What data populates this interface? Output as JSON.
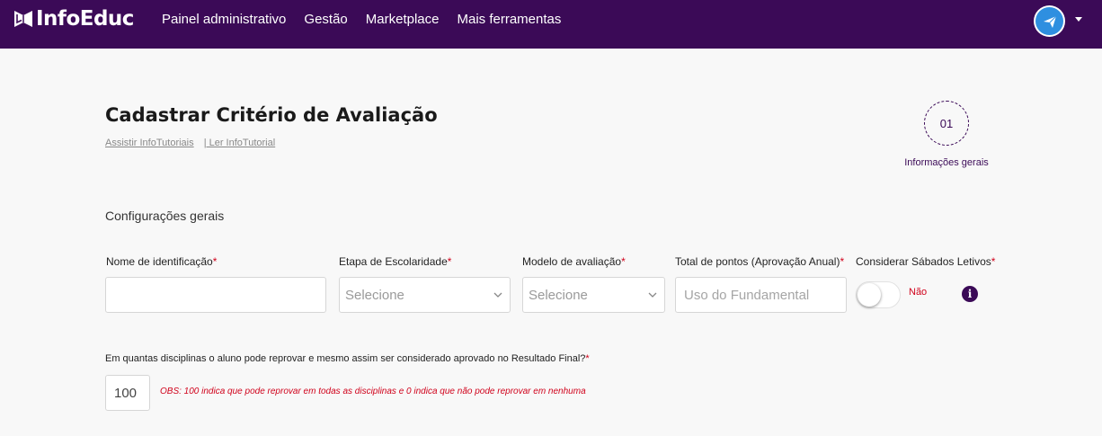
{
  "app": {
    "logo_text": "InfoEduc",
    "brand_color": "#3b0a57",
    "accent_color": "#2e8fe0",
    "required_color": "#d0021b"
  },
  "nav": {
    "items": [
      {
        "label": "Painel administrativo"
      },
      {
        "label": "Gestão"
      },
      {
        "label": "Marketplace"
      },
      {
        "label": "Mais ferramentas"
      }
    ],
    "avatar_icon": "paper-plane-icon",
    "menu_icon": "caret-down-icon"
  },
  "header": {
    "title": "Cadastrar Critério de Avaliação",
    "link_watch": "Assistir InfoTutoriais",
    "link_read": "| Ler InfoTutorial"
  },
  "stepper": {
    "step_number": "01",
    "step_label": "Informações gerais"
  },
  "section": {
    "title": "Configurações gerais"
  },
  "form": {
    "required_mark": "*",
    "name_field": {
      "label": "Nome de identificação",
      "value": "",
      "placeholder": ""
    },
    "stage_field": {
      "label": "Etapa de Escolaridade",
      "selected": "Selecione"
    },
    "model_field": {
      "label": "Modelo de avaliação",
      "selected": "Selecione"
    },
    "points_field": {
      "label": "Total de pontos (Aprovação Anual)",
      "value": "",
      "placeholder": "Uso do Fundamental"
    },
    "saturdays_field": {
      "label": "Considerar Sábados Letivos",
      "state_label": "Não",
      "checked": false
    },
    "info_icon": "info-icon",
    "failures_question": "Em quantas disciplinas o aluno pode reprovar e mesmo assim ser considerado aprovado no Resultado Final?",
    "failures_value": "100",
    "failures_obs": "OBS: 100 indica que pode reprovar em todas as disciplinas e 0 indica que não pode reprovar em nenhuma"
  }
}
